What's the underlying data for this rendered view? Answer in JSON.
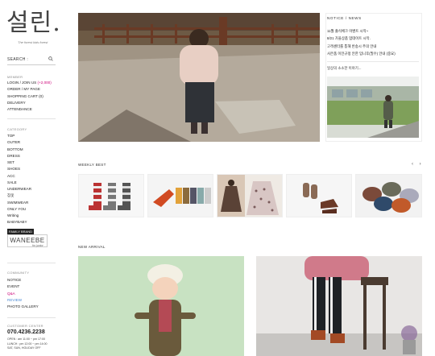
{
  "logo": {
    "text": "설린.",
    "tagline": "The forest kids forest"
  },
  "search": {
    "label": "SEARCH :"
  },
  "member": {
    "title": "MEMBER",
    "items": [
      {
        "label": "LOGIN / JOIN US",
        "extra": "(+2,000)"
      },
      {
        "label": "ORDER / MY PAGE"
      },
      {
        "label": "SHOPPING CART (0)"
      },
      {
        "label": "DELIVERY"
      },
      {
        "label": "ATTENDANCE"
      }
    ]
  },
  "category": {
    "title": "CATEGORY",
    "items": [
      "TOP",
      "OUTER",
      "BOTTOM",
      "DRESS",
      "SET",
      "SHOES",
      "ACC",
      "SALE",
      "UNDERWEAR",
      "잠옷",
      "SWIMWEAR",
      "ONLY YOU",
      "Writing",
      "BABYBABY"
    ]
  },
  "family": {
    "label": "FAMILY BRAND",
    "brand": "WANEEBE",
    "brand_sub": "for junior"
  },
  "community": {
    "title": "COMMUNITY",
    "items": [
      "NOTICE",
      "EVENT",
      "Q&A",
      "REVIEW",
      "PHOTO GALLERY"
    ]
  },
  "customer": {
    "title": "CUSTOMER CENTER",
    "phone": "070.4236.2238",
    "hours": [
      "OPEN : am 11:00 ~ pm 17:00",
      "LUNCH : pm 12:00 ~ pm 14:00",
      "SAT, SUN, HOLIDAY OFF"
    ]
  },
  "notice": {
    "title": "NOTICE / NEWS",
    "items": [
      "11월 출석체크 이벤트 시작~",
      "8/21 가을상품 업데이트 시작.",
      "고객센터를 통해 반송시 주의 안내",
      "사은품 이전규정 안한 입니후(필수) 안내 (중요)"
    ],
    "subtitle": "일상의 소소한 이야기..."
  },
  "weekly_best": {
    "title": "WEEKLY BEST",
    "arrows": "‹ ›"
  },
  "new_arrival": {
    "title": "NEW ARRIVAL"
  },
  "colors": {
    "accent": "#c0007a",
    "text": "#222222",
    "border": "#eeeeee"
  }
}
